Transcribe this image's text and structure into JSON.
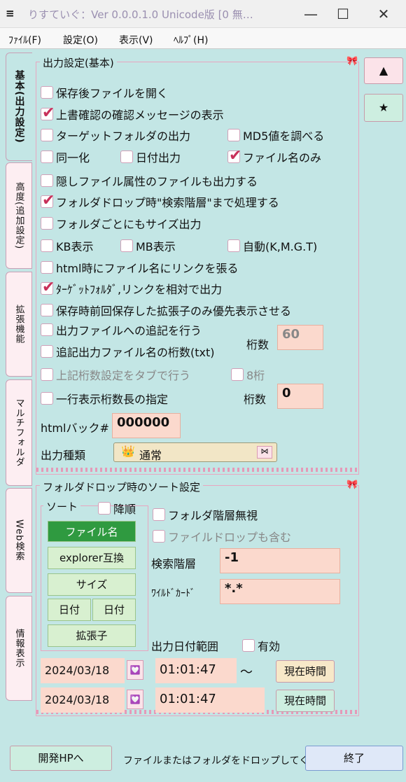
{
  "window": {
    "icon": "≡",
    "title": "りすていぐ：Ver 0.0.0.1.0 Unicode版 [0 無…",
    "controls": {
      "minimize": "—",
      "maximize": "☐",
      "close": "✕"
    }
  },
  "menu": [
    "ﾌｧｲﾙ(F)",
    "設定(O)",
    "表示(V)",
    "ﾍﾙﾌﾟ(H)"
  ],
  "tabs": [
    "基本(出力設定)",
    "高度(追加設定)",
    "拡張機能",
    "マルチフォルダ",
    "Web検索",
    "情報表示"
  ],
  "side_buttons": {
    "up": "▲",
    "star": "★"
  },
  "basic": {
    "title": "出力設定(基本)",
    "options": [
      {
        "label": "保存後ファイルを開く",
        "checked": false
      },
      {
        "label": "上書確認の確認メッセージの表示",
        "checked": true
      },
      {
        "label": "ターゲットフォルダの出力",
        "checked": false
      },
      {
        "label": "MD5値を調べる",
        "checked": false
      },
      {
        "label": "同一化",
        "checked": false
      },
      {
        "label": "日付出力",
        "checked": false
      },
      {
        "label": "ファイル名のみ",
        "checked": true
      },
      {
        "label": "隠しファイル属性のファイルも出力する",
        "checked": false
      },
      {
        "label": "フォルダドロップ時\"検索階層\"まで処理する",
        "checked": true
      },
      {
        "label": "フォルダごとにもサイズ出力",
        "checked": false
      },
      {
        "label": "KB表示",
        "checked": false
      },
      {
        "label": "MB表示",
        "checked": false
      },
      {
        "label": "自動(K,M.G.T)",
        "checked": false
      },
      {
        "label": "html時にファイル名にリンクを張る",
        "checked": false
      },
      {
        "label": "ﾀｰｹﾞｯﾄﾌｫﾙﾀﾞ,リンクを相対で出力",
        "checked": true
      },
      {
        "label": "保存時前回保存した拡張子のみ優先表示させる",
        "checked": false
      },
      {
        "label": "出力ファイルへの追記を行う",
        "checked": false
      },
      {
        "label": "追記出力ファイル名の桁数(txt)",
        "checked": false
      },
      {
        "label": "上記桁数設定をタブで行う",
        "checked": false
      },
      {
        "label": "8桁",
        "checked": false
      },
      {
        "label": "一行表示桁数長の指定",
        "checked": false
      }
    ],
    "digits_label": "桁数",
    "digits_value_1": "60",
    "digits_value_2": "0",
    "html_back_label": "htmlバック#",
    "html_back_value": "000000",
    "output_type_label": "出力種類",
    "output_type_value": "通常"
  },
  "sort": {
    "title": "フォルダドロップ時のソート設定",
    "sub_title": "ソート",
    "desc_label": "降順",
    "buttons": [
      "ファイル名",
      "explorer互換",
      "サイズ",
      "日付",
      "日付",
      "拡張子"
    ],
    "ignore_depth": "フォルダ階層無視",
    "include_file_drop": "ファイルドロップも含む",
    "depth_label": "検索階層",
    "depth_value": "-1",
    "wildcard_label": "ﾜｲﾙﾄﾞｶｰﾄﾞ",
    "wildcard_value": "*.*",
    "date_range_label": "出力日付範囲",
    "date_range_enable": "有効",
    "date1": "2024/03/18",
    "time1": "01:01:47",
    "tilde": "〜",
    "date2": "2024/03/18",
    "time2": "01:01:47",
    "now_button": "現在時間"
  },
  "footer": {
    "hp_button": "開発HPへ",
    "status": "ファイルまたはフォルダをドロップしてください",
    "exit_button": "終了"
  },
  "colors": {
    "background": "#c3e6e5",
    "accent_pink": "#e8a6c0",
    "field": "#fbd9cd",
    "selected": "#2f9a40"
  }
}
